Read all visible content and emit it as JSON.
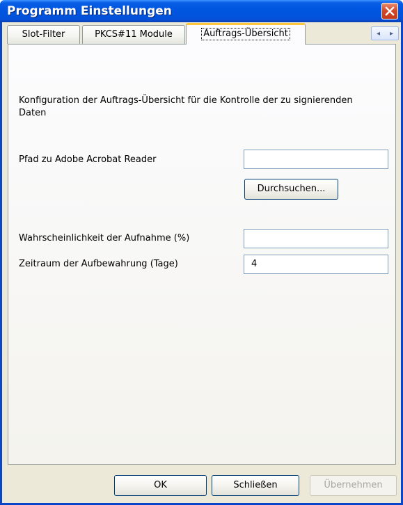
{
  "window": {
    "title": "Programm Einstellungen"
  },
  "tabs": [
    {
      "label": "Slot-Filter",
      "active": false
    },
    {
      "label": "PKCS#11 Module",
      "active": false
    },
    {
      "label": "Auftrags-Übersicht",
      "active": true
    }
  ],
  "tab_scroll": {
    "left_glyph": "◂",
    "right_glyph": "▸"
  },
  "content": {
    "description": "Konfiguration der Auftrags-Übersicht für die Kontrolle der zu signierenden Daten",
    "acrobat_label": "Pfad zu Adobe Acrobat Reader",
    "acrobat_value": "",
    "browse_label": "Durchsuchen...",
    "probability_label": "Wahrscheinlichkeit der Aufnahme (%)",
    "probability_value": "",
    "retention_label": "Zeitraum der Aufbewahrung (Tage)",
    "retention_value": "4"
  },
  "footer": {
    "ok_label": "OK",
    "close_label": "Schließen",
    "apply_label": "Übernehmen"
  },
  "colors": {
    "titlebar_blue": "#0054de",
    "window_bg": "#ece9d8",
    "close_red": "#d5482a",
    "active_tab_highlight": "#ffc83c"
  }
}
